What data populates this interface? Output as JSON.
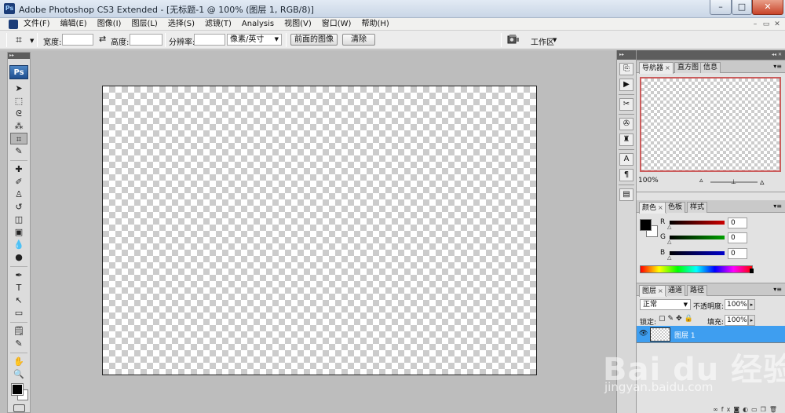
{
  "window": {
    "app_icon": "Ps",
    "title": "Adobe Photoshop CS3 Extended - [无标题-1 @ 100% (图层 1, RGB/8)]",
    "min_label": "–",
    "max_label": "□",
    "close_label": "✕"
  },
  "menu": {
    "items": [
      "文件(F)",
      "编辑(E)",
      "图像(I)",
      "图层(L)",
      "选择(S)",
      "滤镜(T)",
      "Analysis",
      "视图(V)",
      "窗口(W)",
      "帮助(H)"
    ]
  },
  "options": {
    "tool_icon": "crop-icon",
    "width_label": "宽度:",
    "width_value": "",
    "swap_icon": "swap-icon",
    "height_label": "高度:",
    "height_value": "",
    "resolution_label": "分辨率:",
    "resolution_value": "",
    "unit": "像素/英寸",
    "front_image_button": "前面的图像",
    "clear_button": "清除",
    "workspace_label": "工作区",
    "workspace_arrow": "▼"
  },
  "toolbox": {
    "logo": "Ps",
    "tools": [
      {
        "name": "move-tool-icon",
        "glyph": "➤"
      },
      {
        "name": "marquee-tool-icon",
        "glyph": "⬚"
      },
      {
        "name": "lasso-tool-icon",
        "glyph": "ᘓ"
      },
      {
        "name": "magic-wand-tool-icon",
        "glyph": "⁂"
      },
      {
        "name": "crop-tool-icon",
        "glyph": "⌗"
      },
      {
        "name": "slice-tool-icon",
        "glyph": "✎"
      },
      {
        "name": "healing-brush-tool-icon",
        "glyph": "✚"
      },
      {
        "name": "brush-tool-icon",
        "glyph": "✐"
      },
      {
        "name": "clone-stamp-tool-icon",
        "glyph": "♙"
      },
      {
        "name": "history-brush-tool-icon",
        "glyph": "↺"
      },
      {
        "name": "eraser-tool-icon",
        "glyph": "◫"
      },
      {
        "name": "gradient-tool-icon",
        "glyph": "▣"
      },
      {
        "name": "blur-tool-icon",
        "glyph": "💧"
      },
      {
        "name": "dodge-tool-icon",
        "glyph": "●"
      },
      {
        "name": "pen-tool-icon",
        "glyph": "✒"
      },
      {
        "name": "type-tool-icon",
        "glyph": "T"
      },
      {
        "name": "path-selection-tool-icon",
        "glyph": "↖"
      },
      {
        "name": "shape-tool-icon",
        "glyph": "▭"
      },
      {
        "name": "notes-tool-icon",
        "glyph": "🗒"
      },
      {
        "name": "eyedropper-tool-icon",
        "glyph": "✎"
      },
      {
        "name": "hand-tool-icon",
        "glyph": "✋"
      },
      {
        "name": "zoom-tool-icon",
        "glyph": "🔍"
      }
    ],
    "active_tool": "crop-tool-icon",
    "foreground_color": "#000000",
    "background_color": "#ffffff"
  },
  "navigator": {
    "tabs": [
      "导航器",
      "直方图",
      "信息"
    ],
    "active_tab": "导航器",
    "zoom": "100%",
    "preview_border_color": "#cb5c5c"
  },
  "color_panel": {
    "tabs": [
      "颜色",
      "色板",
      "样式"
    ],
    "active_tab": "颜色",
    "channels": [
      {
        "label": "R",
        "value": "0",
        "color": "#cc0000"
      },
      {
        "label": "G",
        "value": "0",
        "color": "#00a000"
      },
      {
        "label": "B",
        "value": "0",
        "color": "#0000cc"
      }
    ]
  },
  "layers_panel": {
    "tabs": [
      "图层",
      "通道",
      "路径"
    ],
    "active_tab": "图层",
    "blend_mode": "正常",
    "opacity_label": "不透明度:",
    "opacity_value": "100%",
    "lock_label": "锁定:",
    "fill_label": "填充:",
    "fill_value": "100%",
    "layers": [
      {
        "name": "图层 1",
        "visible": true,
        "selected": true
      }
    ],
    "selection_color": "#3e9ef0"
  },
  "watermark": {
    "logo_text": "Bai du 经验",
    "url": "jingyan.baidu.com"
  }
}
